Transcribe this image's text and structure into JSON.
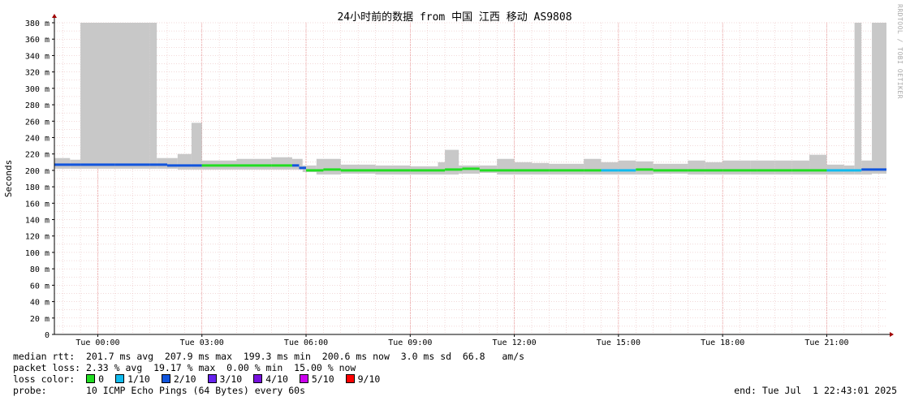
{
  "chart_data": {
    "type": "area",
    "title": "24小时前的数据 from 中国 江西 移动 AS9808",
    "ylabel": "Seconds",
    "xlabel": "",
    "ylim": [
      0,
      380
    ],
    "yunit": "m",
    "yticks": [
      0,
      20,
      40,
      60,
      80,
      100,
      120,
      140,
      160,
      180,
      200,
      220,
      240,
      260,
      280,
      300,
      320,
      340,
      360,
      380
    ],
    "xlim_hours": [
      -1.25,
      22.72
    ],
    "xticks": [
      {
        "label": "Tue 00:00",
        "hour": 0
      },
      {
        "label": "Tue 03:00",
        "hour": 3
      },
      {
        "label": "Tue 06:00",
        "hour": 6
      },
      {
        "label": "Tue 09:00",
        "hour": 9
      },
      {
        "label": "Tue 12:00",
        "hour": 12
      },
      {
        "label": "Tue 15:00",
        "hour": 15
      },
      {
        "label": "Tue 18:00",
        "hour": 18
      },
      {
        "label": "Tue 21:00",
        "hour": 21
      }
    ],
    "grid": true,
    "series": [
      {
        "name": "median rtt",
        "points": [
          [
            -1.25,
            207
          ],
          [
            -0.5,
            207
          ],
          [
            0.5,
            207
          ],
          [
            1.5,
            207
          ],
          [
            2,
            206
          ],
          [
            3,
            206
          ],
          [
            4,
            206
          ],
          [
            5,
            206
          ],
          [
            5.6,
            206
          ],
          [
            5.8,
            203
          ],
          [
            6.0,
            200
          ],
          [
            6.5,
            201
          ],
          [
            7.0,
            200
          ],
          [
            8.0,
            200
          ],
          [
            9.0,
            200
          ],
          [
            10.0,
            201
          ],
          [
            10.5,
            202
          ],
          [
            11.0,
            200
          ],
          [
            12.0,
            200
          ],
          [
            13.0,
            200
          ],
          [
            14.0,
            200
          ],
          [
            14.5,
            200
          ],
          [
            15.0,
            200
          ],
          [
            15.5,
            201
          ],
          [
            16.0,
            200
          ],
          [
            17.0,
            200
          ],
          [
            18.0,
            200
          ],
          [
            19.0,
            200
          ],
          [
            20.0,
            200
          ],
          [
            21.0,
            200
          ],
          [
            22.0,
            201
          ],
          [
            22.72,
            201
          ]
        ]
      },
      {
        "name": "ping jitter",
        "upper": [
          [
            -1.25,
            215
          ],
          [
            -0.8,
            213
          ],
          [
            -0.5,
            380
          ],
          [
            1.5,
            380
          ],
          [
            1.7,
            215
          ],
          [
            2.3,
            220
          ],
          [
            2.7,
            258
          ],
          [
            3.0,
            212
          ],
          [
            4.0,
            214
          ],
          [
            5.0,
            216
          ],
          [
            5.6,
            214
          ],
          [
            5.9,
            206
          ],
          [
            6.3,
            214
          ],
          [
            7.0,
            207
          ],
          [
            8.0,
            206
          ],
          [
            9.0,
            205
          ],
          [
            9.8,
            210
          ],
          [
            10.0,
            225
          ],
          [
            10.4,
            206
          ],
          [
            11.0,
            206
          ],
          [
            11.5,
            214
          ],
          [
            12.0,
            210
          ],
          [
            12.5,
            209
          ],
          [
            13.0,
            208
          ],
          [
            14.0,
            214
          ],
          [
            14.5,
            210
          ],
          [
            15.0,
            212
          ],
          [
            15.5,
            211
          ],
          [
            16.0,
            208
          ],
          [
            17.0,
            212
          ],
          [
            17.5,
            210
          ],
          [
            18.0,
            212
          ],
          [
            18.8,
            212
          ],
          [
            19.5,
            212
          ],
          [
            20.0,
            212
          ],
          [
            20.5,
            219
          ],
          [
            21.0,
            207
          ],
          [
            21.5,
            206
          ],
          [
            21.8,
            380
          ],
          [
            22.0,
            212
          ],
          [
            22.3,
            380
          ],
          [
            22.72,
            380
          ]
        ]
      }
    ],
    "loss_colors": [
      "#22dd22",
      "#11bbee",
      "#1155dd",
      "#6622ee",
      "#7711dd",
      "#cc00ee",
      "#ff0000"
    ]
  },
  "stats": {
    "median_rtt": "median rtt:  201.7 ms avg  207.9 ms max  199.3 ms min  200.6 ms now  3.0 ms sd  66.8   am/s",
    "packet_loss": "packet loss: 2.33 % avg  19.17 % max  0.00 % min  15.00 % now",
    "loss_color_label": "loss color:",
    "loss_items": [
      {
        "label": "0",
        "color": "#22dd22"
      },
      {
        "label": "1/10",
        "color": "#11bbee"
      },
      {
        "label": "2/10",
        "color": "#1155dd"
      },
      {
        "label": "3/10",
        "color": "#6622ee"
      },
      {
        "label": "4/10",
        "color": "#7711dd"
      },
      {
        "label": "5/10",
        "color": "#cc00ee"
      },
      {
        "label": "9/10",
        "color": "#ff0000"
      }
    ],
    "probe": "probe:       10 ICMP Echo Pings (64 Bytes) every 60s",
    "end": "end: Tue Jul  1 22:43:01 2025"
  },
  "watermark": "RRDTOOL / TOBI OETIKER"
}
